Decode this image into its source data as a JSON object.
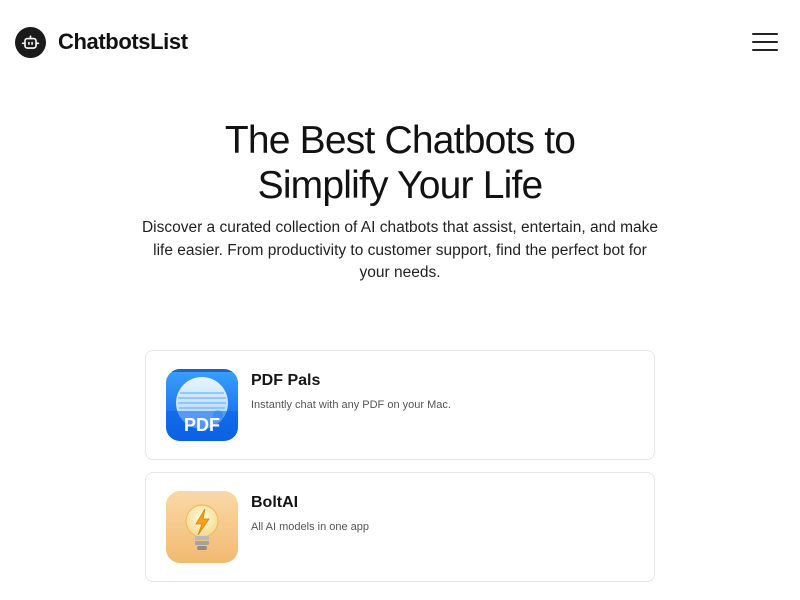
{
  "header": {
    "brand_name": "ChatbotsList",
    "logo_icon": "robot-icon",
    "menu_icon": "hamburger-menu-icon"
  },
  "hero": {
    "title": "The Best Chatbots to Simplify Your Life",
    "subtitle": "Discover a curated collection of AI chatbots that assist, entertain, and make life easier. From productivity to customer support, find the perfect bot for your needs."
  },
  "chatbots": [
    {
      "name": "PDF Pals",
      "description": "Instantly chat with any PDF on your Mac.",
      "icon": "pdf-document-icon",
      "icon_label": "PDF"
    },
    {
      "name": "BoltAI",
      "description": "All AI models in one app",
      "icon": "lightbulb-bolt-icon"
    }
  ]
}
